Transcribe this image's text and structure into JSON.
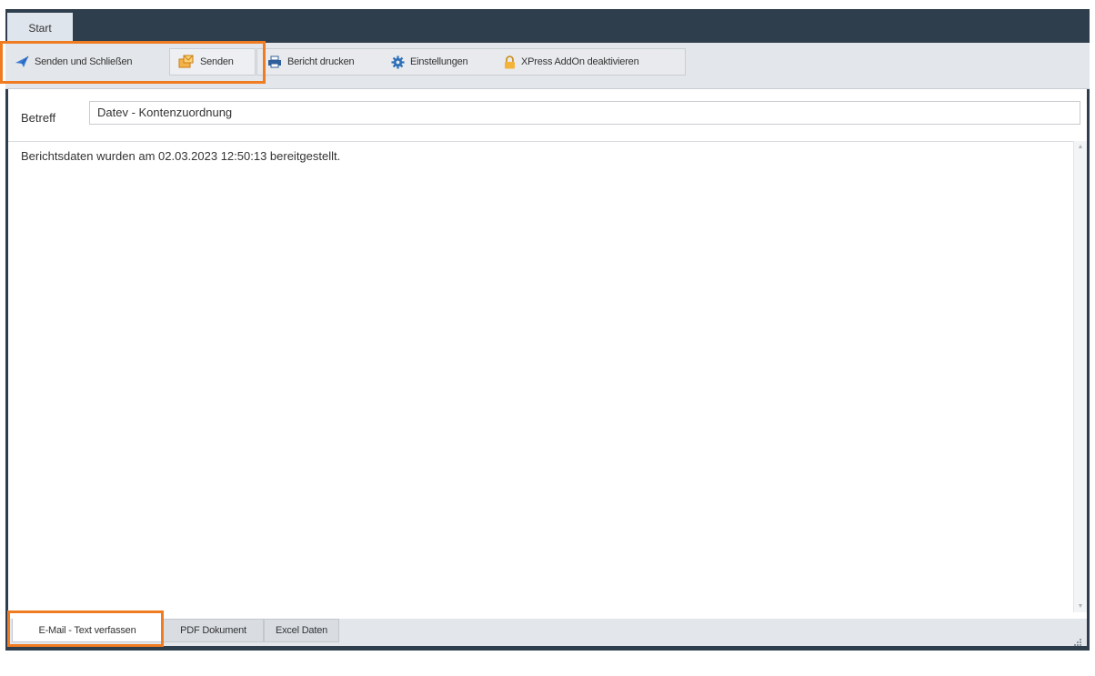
{
  "ribbon": {
    "tab_label": "Start"
  },
  "toolbar": {
    "send_close_label": "Senden und Schließen",
    "send_label": "Senden",
    "print_label": "Bericht drucken",
    "settings_label": "Einstellungen",
    "addon_label": "XPress AddOn deaktivieren"
  },
  "form": {
    "subject_label": "Betreff",
    "subject_value": "Datev - Kontenzuordnung",
    "body_text": "Berichtsdaten wurden am 02.03.2023 12:50:13 bereitgestellt."
  },
  "bottom_tabs": [
    "E-Mail - Text verfassen",
    "PDF Dokument",
    "Excel Daten"
  ],
  "colors": {
    "accent_highlight": "#f07c22",
    "title_bar": "#2f3e4d",
    "toolbar_bg": "#e3e6ea"
  },
  "icons": [
    "send-icon",
    "send-mail-icon",
    "printer-icon",
    "gear-icon",
    "lock-icon",
    "resize-grip-icon"
  ]
}
